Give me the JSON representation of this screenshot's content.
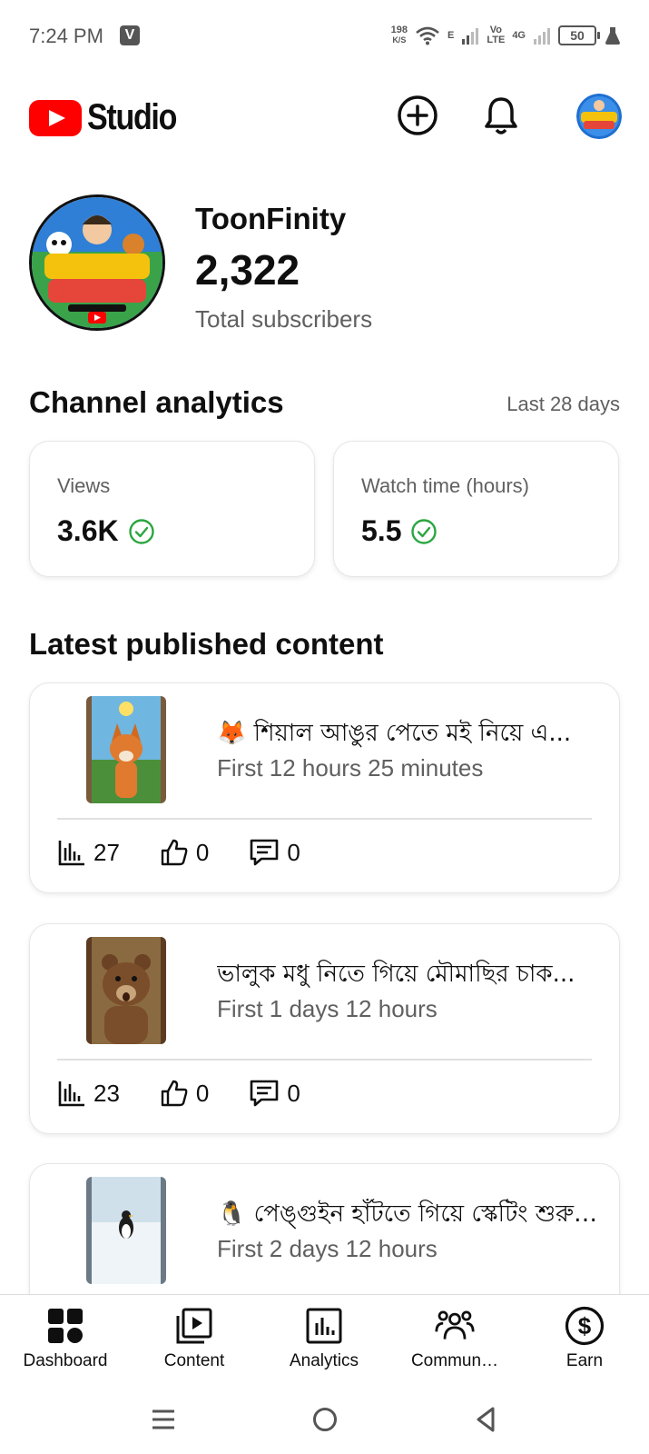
{
  "status_bar": {
    "time": "7:24 PM",
    "notification_badge": "V",
    "net_speed_value": "198",
    "net_speed_unit": "K/S",
    "network_e": "E",
    "volte_top": "Vo",
    "volte_bottom": "LTE",
    "network_4g": "4G",
    "battery": "50"
  },
  "header": {
    "brand": "Studio",
    "icons": [
      "create-plus-icon",
      "notification-bell-icon",
      "account-avatar"
    ]
  },
  "channel": {
    "name": "ToonFinity",
    "subscribers": "2,322",
    "subscribers_label": "Total subscribers"
  },
  "analytics": {
    "title": "Channel analytics",
    "period": "Last 28 days",
    "cards": [
      {
        "label": "Views",
        "value": "3.6K"
      },
      {
        "label": "Watch time (hours)",
        "value": "5.5"
      }
    ]
  },
  "latest": {
    "title": "Latest published content",
    "items": [
      {
        "title": "🦊 শিয়াল আঙুর পেতে মই নিয়ে এ...",
        "subtitle": "First 12 hours 25 minutes",
        "views": "27",
        "likes": "0",
        "comments": "0"
      },
      {
        "title": "ভালুক মধু নিতে গিয়ে মৌমাছির চাক...",
        "subtitle": "First 1 days 12 hours",
        "views": "23",
        "likes": "0",
        "comments": "0"
      },
      {
        "title": "🐧 পেঙ্গুইন হাঁটতে গিয়ে স্কেটিং শুরু ...",
        "subtitle": "First 2 days 12 hours",
        "views": "",
        "likes": "",
        "comments": ""
      }
    ]
  },
  "bottom_nav": {
    "items": [
      {
        "label": "Dashboard",
        "icon": "dashboard-icon"
      },
      {
        "label": "Content",
        "icon": "content-icon"
      },
      {
        "label": "Analytics",
        "icon": "analytics-icon"
      },
      {
        "label": "Commun…",
        "icon": "community-icon"
      },
      {
        "label": "Earn",
        "icon": "earn-icon"
      }
    ]
  },
  "colors": {
    "brand_red": "#ff0000",
    "success_green": "#2ba640",
    "text_secondary": "#606060"
  }
}
